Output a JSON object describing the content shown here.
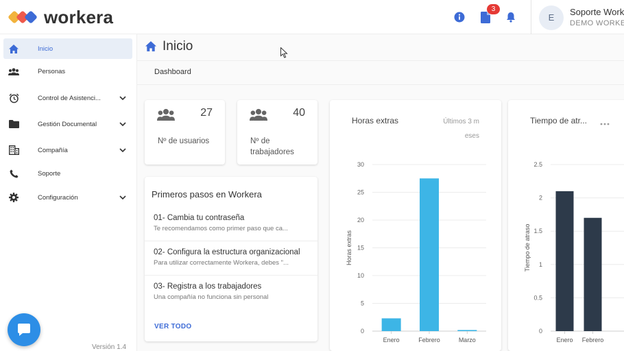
{
  "header": {
    "brand": "workera",
    "notification_count": "3",
    "user": {
      "initial": "E",
      "name": "Soporte Workera",
      "org": "DEMO WORKERA"
    },
    "icons": [
      "info-icon",
      "document-icon",
      "bell-icon"
    ],
    "accent": "#3d6bd6"
  },
  "sidebar": {
    "items": [
      {
        "label": "Inicio",
        "icon": "home-icon",
        "active": true
      },
      {
        "label": "Personas",
        "icon": "people-icon"
      },
      {
        "label": "Control de Asistenci...",
        "icon": "alarm-icon",
        "expandable": true
      },
      {
        "label": "Gestión Documental",
        "icon": "folder-icon",
        "expandable": true
      },
      {
        "label": "Compañía",
        "icon": "building-icon",
        "expandable": true
      },
      {
        "label": "Soporte",
        "icon": "phone-icon"
      },
      {
        "label": "Configuración",
        "icon": "gear-icon",
        "expandable": true
      }
    ],
    "version": "Versión 1.4"
  },
  "page": {
    "title": "Inicio",
    "breadcrumb": "Dashboard"
  },
  "stats": [
    {
      "value": "27",
      "label": "Nº de usuarios"
    },
    {
      "value": "40",
      "label": "Nº de trabajadores"
    }
  ],
  "steps": {
    "title": "Primeros pasos en Workera",
    "items": [
      {
        "title": "01- Cambia tu contraseña",
        "desc": "Te recomendamos como primer paso que ca..."
      },
      {
        "title": "02- Configura la estructura organizacional",
        "desc": "Para utilizar correctamente Workera, debes \"..."
      },
      {
        "title": "03- Registra a los trabajadores",
        "desc": "Una compañía no funciona sin personal"
      }
    ],
    "view_all": "VER TODO"
  },
  "charts": {
    "overtime": {
      "title": "Horas extras",
      "subtitle_1": "Últimos 3 m",
      "subtitle_2": "eses"
    },
    "delay": {
      "title": "Tiempo de atr..."
    }
  },
  "chart_data": [
    {
      "type": "bar",
      "title": "Horas extras",
      "ylabel": "Horas extras",
      "categories": [
        "Enero",
        "Febrero",
        "Marzo"
      ],
      "values": [
        2.3,
        27.5,
        0.2
      ],
      "yticks": [
        0,
        5,
        10,
        15,
        20,
        25,
        30
      ],
      "ylim": [
        0,
        30
      ],
      "color": "#3db5e6",
      "grid": true
    },
    {
      "type": "bar",
      "title": "Tiempo de atr...",
      "ylabel": "Tiempo de atraso",
      "categories": [
        "Enero",
        "Febrero"
      ],
      "values": [
        2.1,
        1.7
      ],
      "yticks": [
        0,
        0.5,
        1,
        1.5,
        2,
        2.5
      ],
      "ylim": [
        0,
        2.5
      ],
      "color": "#2d3a4a",
      "grid": true
    }
  ]
}
